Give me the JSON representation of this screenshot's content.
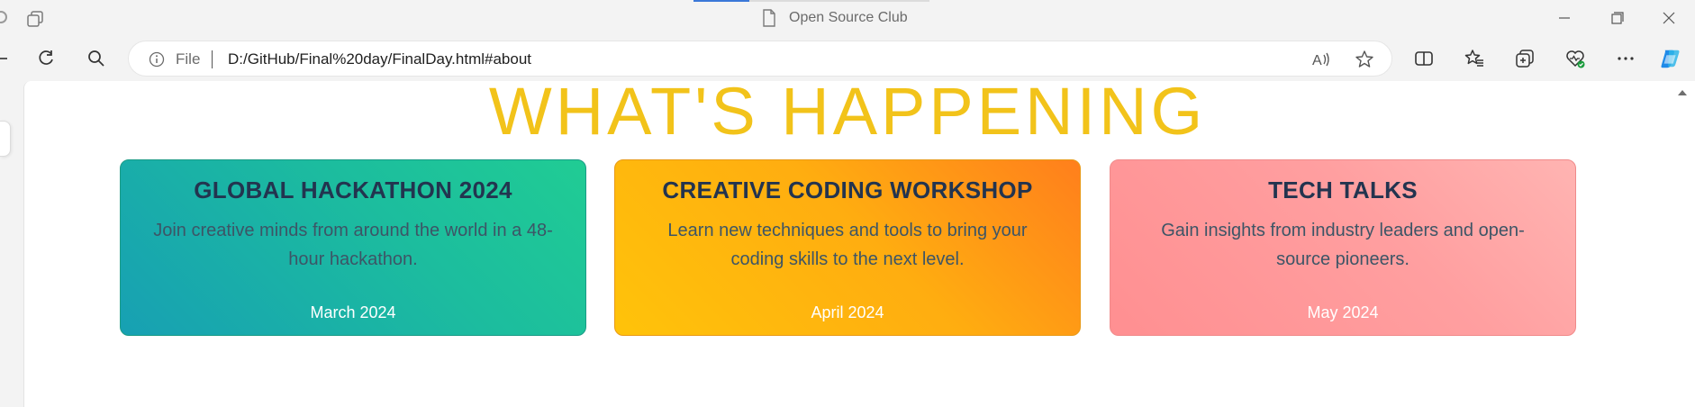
{
  "window": {
    "tab_title": "Open Source Club"
  },
  "toolbar": {
    "address_scheme_label": "File",
    "url": "D:/GitHub/Final%20day/FinalDay.html#about"
  },
  "page": {
    "headline": "WHAT'S HAPPENING",
    "cards": [
      {
        "title": "GLOBAL HACKATHON 2024",
        "description": "Join creative minds from around the world in a 48-hour hackathon.",
        "date": "March 2024"
      },
      {
        "title": "CREATIVE CODING WORKSHOP",
        "description": "Learn new techniques and tools to bring your coding skills to the next level.",
        "date": "April 2024"
      },
      {
        "title": "TECH TALKS",
        "description": "Gain insights from industry leaders and open-source pioneers.",
        "date": "May 2024"
      }
    ]
  },
  "colors": {
    "headline": "#f2c31a",
    "card_title": "#23344f",
    "card_teal": "#1cbd9e",
    "card_orange": "#ffad10",
    "card_pink": "#ff9fa0",
    "browser_accent": "#3b78d8"
  },
  "icons": {
    "tabs": "tab-actions-icon",
    "page": "page-icon",
    "minimize": "minimize-icon",
    "maximize": "restore-icon",
    "close": "close-icon",
    "refresh": "refresh-icon",
    "search": "search-icon",
    "info": "info-icon",
    "read_aloud": "read-aloud-icon",
    "favorite": "star-icon",
    "split": "split-screen-icon",
    "favorites": "favorites-icon",
    "collections": "collections-icon",
    "health": "browser-essentials-icon",
    "more": "more-icon",
    "copilot": "copilot-icon"
  }
}
